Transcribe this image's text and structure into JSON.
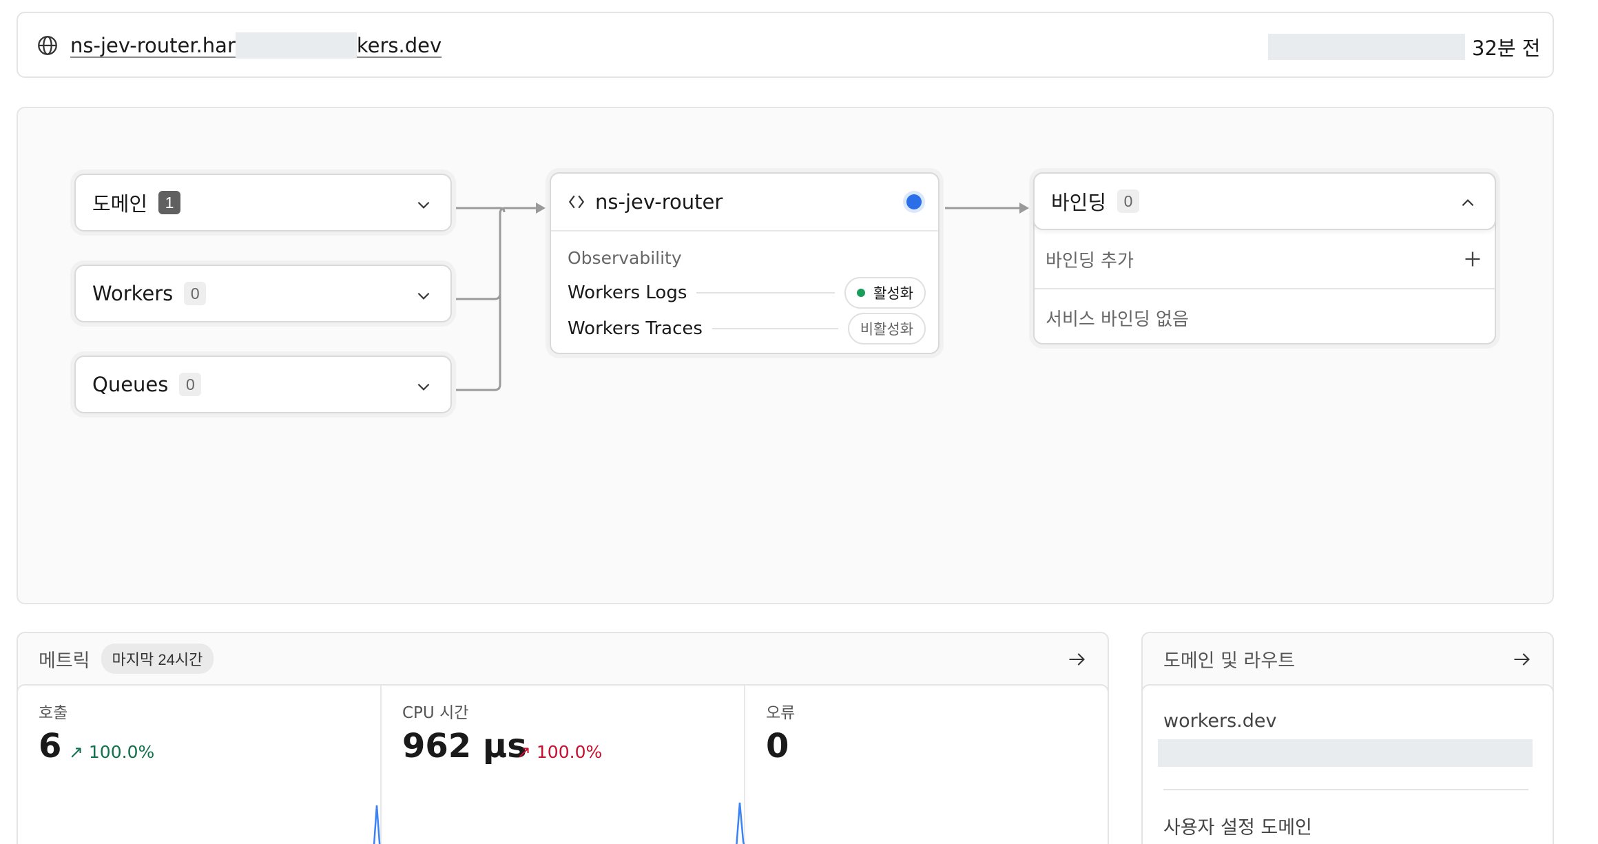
{
  "header": {
    "host_prefix": "ns-jev-router.har",
    "host_suffix": "kers.dev",
    "updated_ago": "32분 전"
  },
  "flow": {
    "inputs": [
      {
        "label": "도메인",
        "count": "1"
      },
      {
        "label": "Workers",
        "count": "0"
      },
      {
        "label": "Queues",
        "count": "0"
      }
    ],
    "worker": {
      "name": "ns-jev-router",
      "section": "Observability",
      "rows": [
        {
          "label": "Workers Logs",
          "status": "활성화"
        },
        {
          "label": "Workers Traces",
          "status": "비활성화"
        }
      ]
    },
    "bindings": {
      "label": "바인딩",
      "count": "0",
      "add_label": "바인딩 추가",
      "empty_label": "서비스 바인딩 없음"
    }
  },
  "metrics": {
    "title": "메트릭",
    "range": "마지막 24시간",
    "cells": [
      {
        "label": "호출",
        "value": "6",
        "delta": "100.0%"
      },
      {
        "label": "CPU 시간",
        "value": "962 μs",
        "delta": "100.0%"
      },
      {
        "label": "오류",
        "value": "0"
      }
    ]
  },
  "domains_panel": {
    "title": "도메인 및 라우트",
    "workers_dev": "workers.dev",
    "custom_domain": "사용자 설정 도메인"
  },
  "colors": {
    "accent": "#2a6ee8",
    "active_dot": "#1a9c5a",
    "good": "#12704a",
    "bad": "#c8102e",
    "spark_blue": "#3b82f6",
    "spark_red": "#ef4444"
  },
  "icons": {
    "globe": "globe-icon",
    "code": "code-icon",
    "chevron_down": "chevron-down-icon",
    "chevron_up": "chevron-up-icon",
    "plus": "plus-icon",
    "arrow_right": "arrow-right-icon",
    "arrow_up_right": "arrow-up-right-icon"
  }
}
